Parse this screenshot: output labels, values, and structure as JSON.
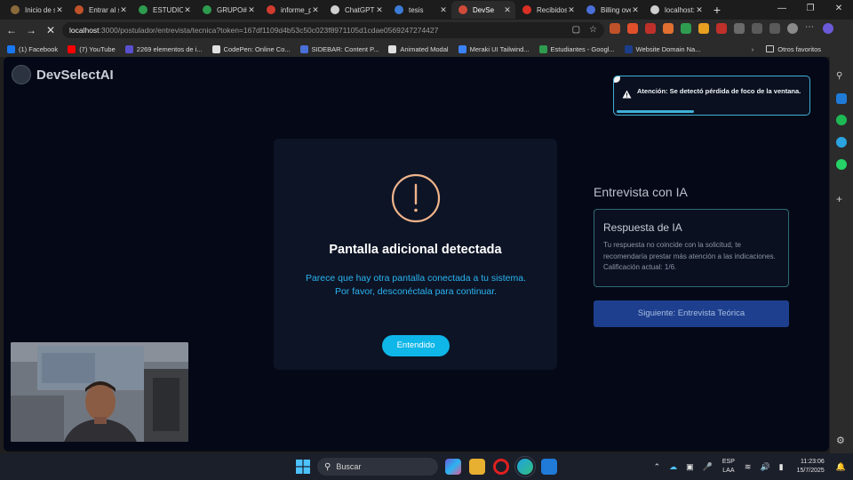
{
  "browser": {
    "tabs": [
      {
        "label": "Inicio de s",
        "color": "#8a6a3a"
      },
      {
        "label": "Entrar al si",
        "color": "#c0522a"
      },
      {
        "label": "ESTUDIO_",
        "color": "#2e9b4f"
      },
      {
        "label": "GRUPO#4",
        "color": "#2e9b4f"
      },
      {
        "label": "informe_p",
        "color": "#d23b2f"
      },
      {
        "label": "ChatGPT",
        "color": "#d0d0d0"
      },
      {
        "label": "tesis",
        "color": "#3b7bd8"
      },
      {
        "label": "DevSe",
        "color": "#d04a3a",
        "active": true
      },
      {
        "label": "Recibidos",
        "color": "#d93025"
      },
      {
        "label": "Billing ove",
        "color": "#4a6fd8"
      },
      {
        "label": "localhost:",
        "color": "#cfcfcf"
      }
    ],
    "new_tab_symbol": "+",
    "url_host": "localhost",
    "url_rest": ":3000/postulador/entrevista/tecnica?token=167df1109d4b53c50c023f8971105d1cdae0569247274427",
    "bookmarks": [
      {
        "label": "(1) Facebook",
        "color": "#1877f2"
      },
      {
        "label": "(7) YouTube",
        "color": "#ff0000"
      },
      {
        "label": "2269 elementos de i...",
        "color": "#5a4fcf"
      },
      {
        "label": "CodePen: Online Co...",
        "color": "#e0e0e0"
      },
      {
        "label": "SIDEBAR: Content P...",
        "color": "#4a6fd8"
      },
      {
        "label": "Animated Modal",
        "color": "#e0e0e0"
      },
      {
        "label": "Meraki UI Tailwind...",
        "color": "#3b82f6"
      },
      {
        "label": "Estudiantes - Googl...",
        "color": "#2e9b4f"
      },
      {
        "label": "Website Domain Na...",
        "color": "#1a3e8a"
      }
    ],
    "other_favorites": "Otros favoritos"
  },
  "app": {
    "brand": "DevSelectAI",
    "toast": {
      "message": "Atención: Se detectó pérdida de foco de la ventana.",
      "progress": 0.4
    },
    "modal": {
      "title": "Pantalla adicional detectada",
      "line1": "Parece que hay otra pantalla conectada a tu sistema.",
      "line2": "Por favor, desconéctala para continuar.",
      "button": "Entendido"
    },
    "interview": {
      "title": "Entrevista con IA",
      "card_title": "Respuesta de IA",
      "card_text": "Tu respuesta no coincide con la solicitud, te recomendaría prestar más atención a las indicaciones. Calificación actual: 1/6.",
      "next_button": "Siguiente: Entrevista Teórica"
    }
  },
  "taskbar": {
    "search_placeholder": "Buscar",
    "lang_top": "ESP",
    "lang_bottom": "LAA",
    "time": "11:23:06",
    "date": "15/7/2025"
  },
  "colors": {
    "accent": "#0fb6e8",
    "warning_icon": "#f0b48a",
    "next_button": "#1e3f8e"
  }
}
